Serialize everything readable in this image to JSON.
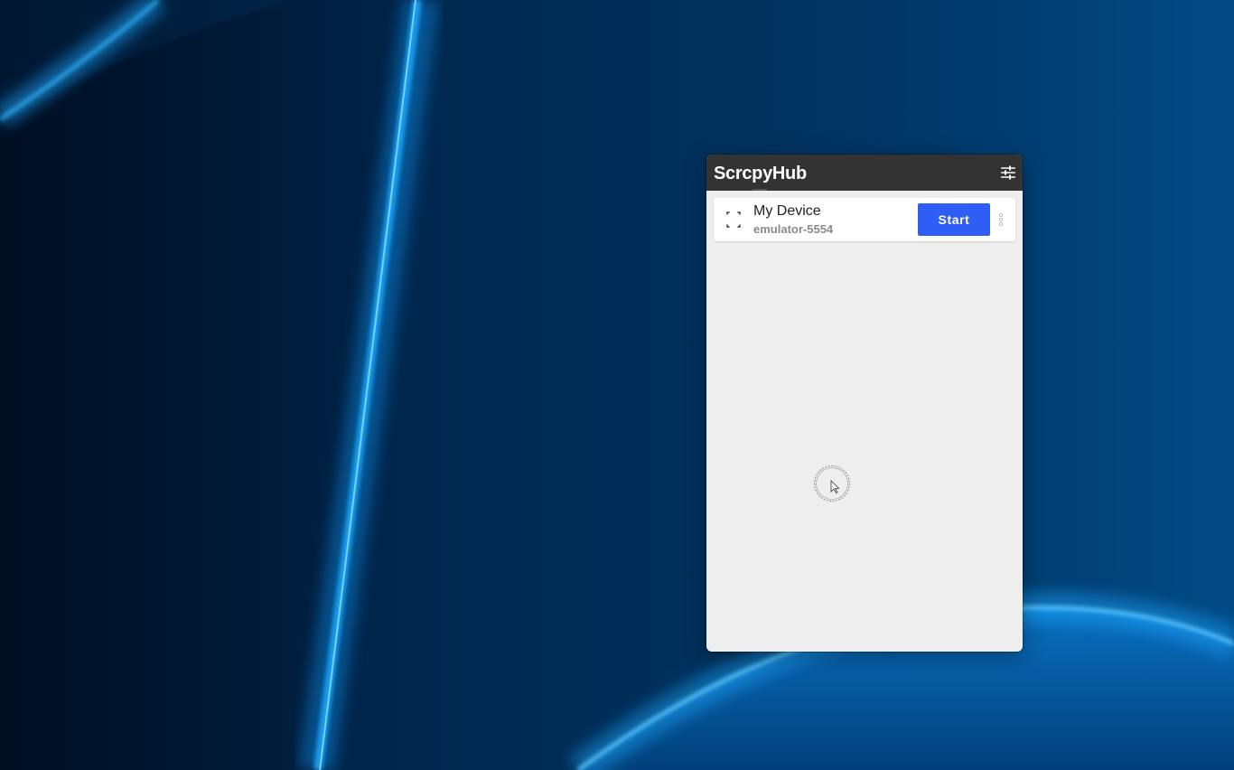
{
  "app": {
    "title": "ScrcpyHub",
    "settings_icon": "tune-sliders-icon"
  },
  "devices": [
    {
      "name": "My Device",
      "serial": "emulator-5554",
      "icon": "device-loading-icon",
      "start_label": "Start",
      "more_icon": "more-vertical-icon"
    }
  ],
  "colors": {
    "titlebar": "#333333",
    "content_bg": "#eeeeee",
    "card_bg": "#ffffff",
    "accent": "#2e5ef5",
    "desktop_bg": "#01315e",
    "glow": "#1aa9ff"
  }
}
